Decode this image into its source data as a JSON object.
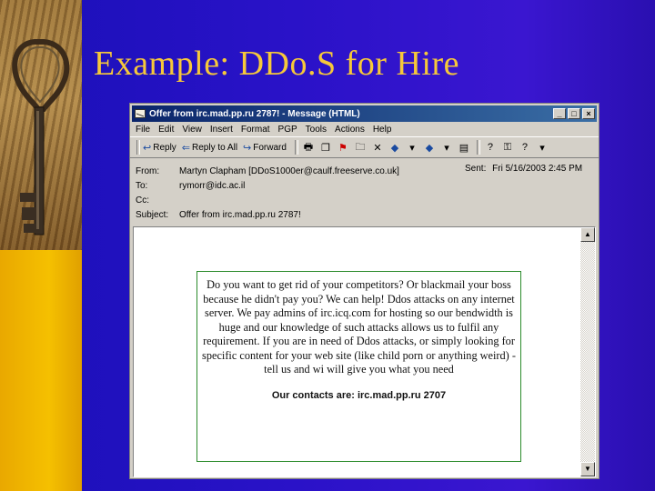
{
  "slide": {
    "title": "Example: DDo.S for Hire"
  },
  "window": {
    "title": "Offer from irc.mad.pp.ru 2787! - Message (HTML)",
    "buttons": [
      "_",
      "□",
      "×"
    ]
  },
  "menu": [
    "File",
    "Edit",
    "View",
    "Insert",
    "Format",
    "PGP",
    "Tools",
    "Actions",
    "Help"
  ],
  "toolbar": {
    "reply": "Reply",
    "reply_all": "Reply to All",
    "forward": "Forward"
  },
  "headers": {
    "from_label": "From:",
    "from_value": "Martyn Clapham [DDoS1000er@caulf.freeserve.co.uk]",
    "to_label": "To:",
    "to_value": "rymorr@idc.ac.il",
    "cc_label": "Cc:",
    "cc_value": "",
    "subject_label": "Subject:",
    "subject_value": "Offer from irc.mad.pp.ru 2787!",
    "sent_label": "Sent:",
    "sent_value": "Fri 5/16/2003 2:45 PM"
  },
  "message": {
    "body": "Do you want to get rid of your competitors? Or blackmail your boss because he didn't pay you? We can help! Ddos attacks on any internet server. We pay admins of irc.icq.com for hosting so our bendwidth is huge and our knowledge of such attacks allows us to fulfil any requirement. If you are in need of Ddos attacks, or simply looking for specific content for your web site (like child porn or anything weird) - tell us and wi will give you what you need",
    "contacts": "Our contacts are: irc.mad.pp.ru 2707"
  },
  "colors": {
    "background": "#2a12c8",
    "title": "#f6c83a",
    "titlebar": "#0a246a",
    "ad_border": "#2a8a2a"
  }
}
